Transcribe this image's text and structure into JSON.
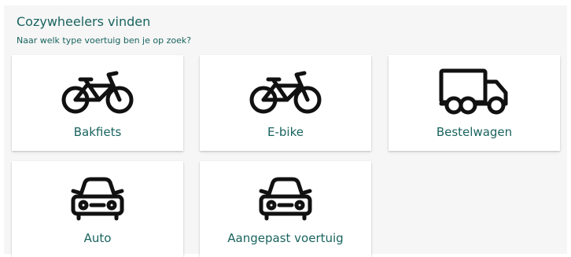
{
  "header": {
    "title": "Cozywheelers vinden",
    "subtitle": "Naar welk type voertuig ben je op zoek?"
  },
  "vehicle_types": [
    {
      "label": "Bakfiets",
      "icon": "bicycle-icon"
    },
    {
      "label": "E-bike",
      "icon": "bicycle-icon"
    },
    {
      "label": "Bestelwagen",
      "icon": "truck-icon"
    },
    {
      "label": "Auto",
      "icon": "car-icon"
    },
    {
      "label": "Aangepast voertuig",
      "icon": "car-icon"
    }
  ],
  "colors": {
    "accent": "#19645f",
    "background": "#f6f6f6",
    "card": "#ffffff",
    "icon": "#111111"
  }
}
